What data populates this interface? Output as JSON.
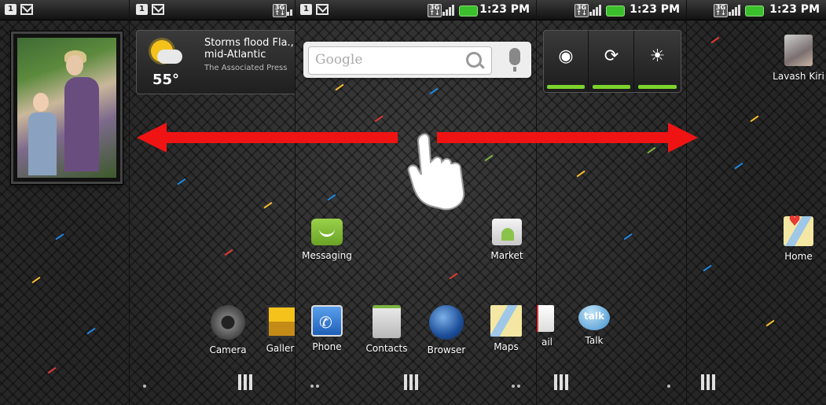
{
  "status_bar": {
    "time": "1:23 PM"
  },
  "weather_widget": {
    "temperature": "55°",
    "headline_line1": "Storms flood Fla., be",
    "headline_line2": "mid-Atlantic",
    "source": "The Associated Press"
  },
  "search_widget": {
    "placeholder": "Google"
  },
  "apps": {
    "messaging": "Messaging",
    "market": "Market",
    "camera": "Camera",
    "gallery": "Gallery",
    "phone": "Phone",
    "contacts": "Contacts",
    "browser": "Browser",
    "maps": "Maps",
    "gmail_partial": "ail",
    "talk": "Talk",
    "lavash": "Lavash Kiri",
    "home": "Home"
  },
  "icons": {
    "talk_text": "talk"
  },
  "colors": {
    "arrow": "#f01313",
    "battery": "#3cbf2d",
    "power_bar": "#7cd32c"
  }
}
